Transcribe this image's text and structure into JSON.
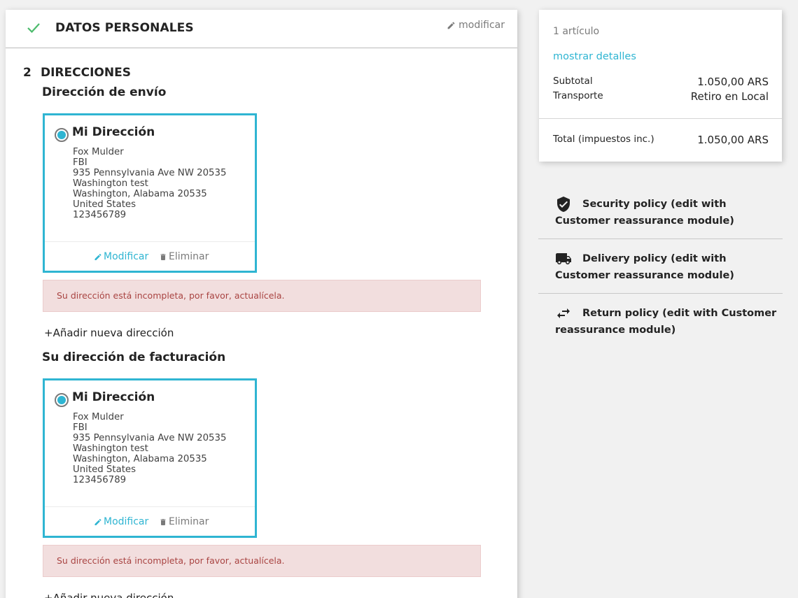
{
  "step1": {
    "title": "DATOS PERSONALES",
    "edit_label": "modificar"
  },
  "step2": {
    "number": "2",
    "title": "DIRECCIONES"
  },
  "shipping": {
    "section_title": "Dirección de envío",
    "card": {
      "alias": "Mi Dirección",
      "lines": [
        "Fox Mulder",
        "FBI",
        "935 Pennsylvania Ave NW 20535",
        "Washington test",
        "Washington, Alabama 20535",
        "United States",
        "123456789"
      ],
      "edit_label": "Modificar",
      "delete_label": "Eliminar"
    },
    "alert": "Su dirección está incompleta, por favor, actualícela.",
    "add_label": "Añadir nueva dirección"
  },
  "billing": {
    "section_title": "Su dirección de facturación",
    "card": {
      "alias": "Mi Dirección",
      "lines": [
        "Fox Mulder",
        "FBI",
        "935 Pennsylvania Ave NW 20535",
        "Washington test",
        "Washington, Alabama 20535",
        "United States",
        "123456789"
      ],
      "edit_label": "Modificar",
      "delete_label": "Eliminar"
    },
    "alert": "Su dirección está incompleta, por favor, actualícela.",
    "add_label": "Añadir nueva dirección"
  },
  "summary": {
    "items_count": "1 artículo",
    "show_details": "mostrar detalles",
    "subtotal_label": "Subtotal",
    "subtotal_value": "1.050,00 ARS",
    "shipping_label": "Transporte",
    "shipping_value": "Retiro en Local",
    "total_label": "Total (impuestos inc.)",
    "total_value": "1.050,00 ARS"
  },
  "reassurance": [
    {
      "icon": "shield-check-icon",
      "text": "Security policy (edit with Customer reassurance module)"
    },
    {
      "icon": "truck-icon",
      "text": "Delivery policy (edit with Customer reassurance module)"
    },
    {
      "icon": "swap-arrows-icon",
      "text": "Return policy (edit with Customer reassurance module)"
    }
  ],
  "colors": {
    "accent": "#2fb5d2",
    "success": "#4cbb6c",
    "alert_bg": "#f2dede",
    "alert_text": "#a94442"
  }
}
